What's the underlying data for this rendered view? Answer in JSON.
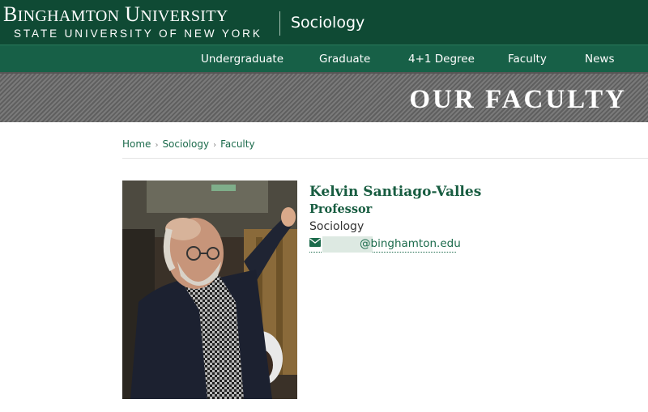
{
  "header": {
    "logo_line1_big_b": "B",
    "logo_line1_b_rest": "INGHAMTON",
    "logo_line1_big_u": " U",
    "logo_line1_u_rest": "NIVERSITY",
    "logo_line2": "STATE UNIVERSITY OF NEW YORK",
    "department": "Sociology"
  },
  "nav": {
    "items": [
      "Undergraduate",
      "Graduate",
      "4+1 Degree",
      "Faculty",
      "News"
    ]
  },
  "banner": {
    "title": "OUR FACULTY"
  },
  "breadcrumb": {
    "items": [
      "Home",
      "Sociology",
      "Faculty"
    ],
    "separator": "›"
  },
  "profile": {
    "name": "Kelvin Santiago-Valles",
    "title": "Professor",
    "department": "Sociology",
    "email_domain": "@binghamton.edu",
    "email_icon": "envelope-icon"
  },
  "colors": {
    "header_bg": "#0f4a34",
    "nav_bg": "#176047",
    "accent_green": "#175c40",
    "link_green": "#1c6b4c"
  }
}
